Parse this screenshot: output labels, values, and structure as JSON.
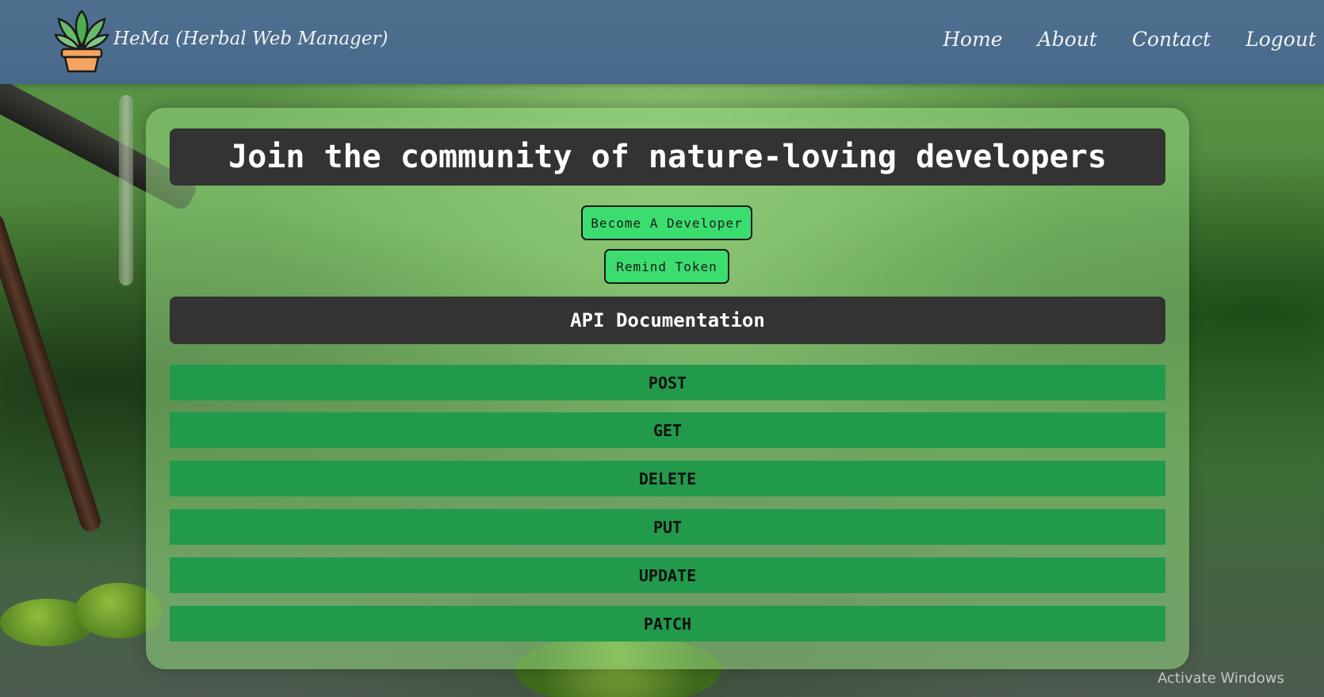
{
  "header": {
    "brand": "HeMa (Herbal Web Manager)",
    "logo_icon": "plant-pot-icon",
    "nav": [
      {
        "label": "Home"
      },
      {
        "label": "About"
      },
      {
        "label": "Contact"
      },
      {
        "label": "Logout"
      }
    ]
  },
  "main": {
    "title": "Join the community of nature-loving developers",
    "become_developer_label": "Become A Developer",
    "remind_token_label": "Remind Token",
    "api_doc_title": "API Documentation",
    "methods": [
      "POST",
      "GET",
      "DELETE",
      "PUT",
      "UPDATE",
      "PATCH"
    ]
  },
  "os_overlay": {
    "watermark": "Activate Windows"
  },
  "colors": {
    "header_bg": "#48698a",
    "dark_bar": "#333333",
    "button_green": "#3bde6e",
    "method_green": "#229a4c"
  }
}
